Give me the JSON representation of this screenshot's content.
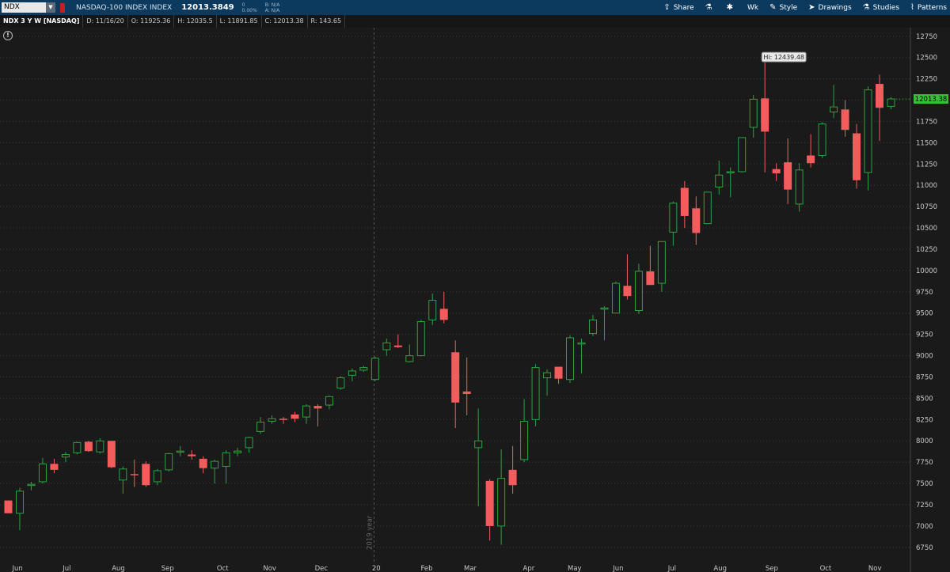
{
  "symbol": "NDX",
  "description": "NASDAQ-100 INDEX INDEX",
  "last": "12013.3849",
  "change": "0",
  "change_pct": "0.00%",
  "bid": "B: N/A",
  "ask": "A: N/A",
  "tools": [
    "Share",
    "Wk",
    "Style",
    "Drawings",
    "Studies",
    "Patterns"
  ],
  "info": {
    "title": "NDX 3 Y W [NASDAQ]",
    "date": "D: 11/16/20",
    "open": "O: 11925.36",
    "high": "H: 12035.5",
    "low": "L: 11891.85",
    "close": "C: 12013.38",
    "range": "R: 143.65"
  },
  "chart_data": {
    "type": "candlestick",
    "ylim": [
      6600,
      12850
    ],
    "y_ticks": [
      6750,
      7000,
      7250,
      7500,
      7750,
      8000,
      8250,
      8500,
      8750,
      9000,
      9250,
      9500,
      9750,
      10000,
      10250,
      10500,
      10750,
      11000,
      11250,
      11500,
      11750,
      12000,
      12250,
      12500,
      12750
    ],
    "x_labels": [
      {
        "label": "Jun",
        "week": 0.8
      },
      {
        "label": "Jul",
        "week": 5.1
      },
      {
        "label": "Aug",
        "week": 9.6
      },
      {
        "label": "Sep",
        "week": 13.9
      },
      {
        "label": "Oct",
        "week": 18.7
      },
      {
        "label": "Nov",
        "week": 22.8
      },
      {
        "label": "Dec",
        "week": 27.3
      },
      {
        "label": "20",
        "week": 32.1
      },
      {
        "label": "Feb",
        "week": 36.5
      },
      {
        "label": "Mar",
        "week": 40.3
      },
      {
        "label": "Apr",
        "week": 45.4
      },
      {
        "label": "May",
        "week": 49.4
      },
      {
        "label": "Jun",
        "week": 53.2
      },
      {
        "label": "Jul",
        "week": 57.9
      },
      {
        "label": "Aug",
        "week": 62.1
      },
      {
        "label": "Sep",
        "week": 66.6
      },
      {
        "label": "Oct",
        "week": 71.3
      },
      {
        "label": "Nov",
        "week": 75.6
      }
    ],
    "year_marker": {
      "label": "2019 year",
      "week": 31.9
    },
    "hi_label": "Hi: 12439.48",
    "last_label": "12013.38",
    "candles": [
      [
        7300,
        7300,
        7180,
        7150
      ],
      [
        7150,
        7450,
        6950,
        7410
      ],
      [
        7480,
        7520,
        7420,
        7490
      ],
      [
        7520,
        7800,
        7500,
        7730
      ],
      [
        7730,
        7790,
        7620,
        7660
      ],
      [
        7810,
        7870,
        7750,
        7840
      ],
      [
        7860,
        7990,
        7840,
        7980
      ],
      [
        7990,
        8000,
        7870,
        7880
      ],
      [
        7870,
        8030,
        7850,
        8000
      ],
      [
        8000,
        8000,
        7680,
        7690
      ],
      [
        7540,
        7700,
        7380,
        7670
      ],
      [
        7610,
        7780,
        7460,
        7600
      ],
      [
        7730,
        7760,
        7460,
        7480
      ],
      [
        7520,
        7670,
        7480,
        7650
      ],
      [
        7660,
        7860,
        7640,
        7850
      ],
      [
        7880,
        7940,
        7820,
        7880
      ],
      [
        7840,
        7890,
        7780,
        7820
      ],
      [
        7790,
        7820,
        7620,
        7680
      ],
      [
        7680,
        7780,
        7500,
        7760
      ],
      [
        7700,
        7890,
        7500,
        7860
      ],
      [
        7860,
        7920,
        7820,
        7880
      ],
      [
        7920,
        8050,
        7860,
        8040
      ],
      [
        8110,
        8280,
        8080,
        8220
      ],
      [
        8230,
        8300,
        8200,
        8260
      ],
      [
        8260,
        8280,
        8200,
        8250
      ],
      [
        8310,
        8340,
        8220,
        8260
      ],
      [
        8280,
        8430,
        8200,
        8410
      ],
      [
        8410,
        8430,
        8170,
        8380
      ],
      [
        8420,
        8530,
        8370,
        8520
      ],
      [
        8620,
        8760,
        8600,
        8740
      ],
      [
        8770,
        8850,
        8700,
        8820
      ],
      [
        8830,
        8880,
        8810,
        8860
      ],
      [
        8720,
        8990,
        8700,
        8970
      ],
      [
        9070,
        9200,
        9000,
        9150
      ],
      [
        9120,
        9250,
        9090,
        9100
      ],
      [
        8930,
        9130,
        8920,
        9000
      ],
      [
        9000,
        9420,
        8990,
        9400
      ],
      [
        9420,
        9730,
        9360,
        9650
      ],
      [
        9550,
        9750,
        9380,
        9420
      ],
      [
        9040,
        9180,
        8150,
        8450
      ],
      [
        8580,
        8980,
        8300,
        8550
      ],
      [
        7920,
        8380,
        7230,
        8000
      ],
      [
        7530,
        7550,
        6830,
        7000
      ],
      [
        7000,
        7900,
        6780,
        7560
      ],
      [
        7660,
        7940,
        7380,
        7480
      ],
      [
        7780,
        8490,
        7750,
        8230
      ],
      [
        8250,
        8900,
        8170,
        8860
      ],
      [
        8740,
        8840,
        8530,
        8800
      ],
      [
        8870,
        8860,
        8670,
        8730
      ],
      [
        8720,
        9240,
        8680,
        9210
      ],
      [
        9150,
        9200,
        8790,
        9150
      ],
      [
        9260,
        9480,
        9230,
        9420
      ],
      [
        9560,
        9580,
        9180,
        9560
      ],
      [
        9500,
        9870,
        9520,
        9850
      ],
      [
        9820,
        10190,
        9660,
        9700
      ],
      [
        9530,
        10080,
        9490,
        9990
      ],
      [
        9990,
        10290,
        9830,
        9830
      ],
      [
        9850,
        10320,
        9750,
        10340
      ],
      [
        10450,
        10810,
        10290,
        10790
      ],
      [
        10970,
        11050,
        10500,
        10640
      ],
      [
        10730,
        10870,
        10300,
        10440
      ],
      [
        10550,
        10920,
        10550,
        10920
      ],
      [
        10980,
        11290,
        10890,
        11120
      ],
      [
        11150,
        11210,
        10860,
        11160
      ],
      [
        11160,
        11560,
        11150,
        11560
      ],
      [
        11680,
        12060,
        11560,
        12010
      ],
      [
        12020,
        12440,
        11150,
        11630
      ],
      [
        11190,
        11260,
        11050,
        11140
      ],
      [
        11270,
        11550,
        10780,
        10950
      ],
      [
        10780,
        11260,
        10690,
        11180
      ],
      [
        11350,
        11600,
        11210,
        11260
      ],
      [
        11350,
        11740,
        11320,
        11720
      ],
      [
        11860,
        12180,
        11790,
        11920
      ],
      [
        11890,
        12000,
        11570,
        11650
      ],
      [
        11610,
        11720,
        10960,
        11060
      ],
      [
        11150,
        12160,
        10940,
        12120
      ],
      [
        12190,
        12300,
        11520,
        11910
      ],
      [
        11925.36,
        12035.5,
        11891.85,
        12013.38
      ]
    ]
  },
  "colors": {
    "up": "#2ea043",
    "down": "#f25c5c",
    "last": "#35c135",
    "bg": "#1a1a1a"
  }
}
